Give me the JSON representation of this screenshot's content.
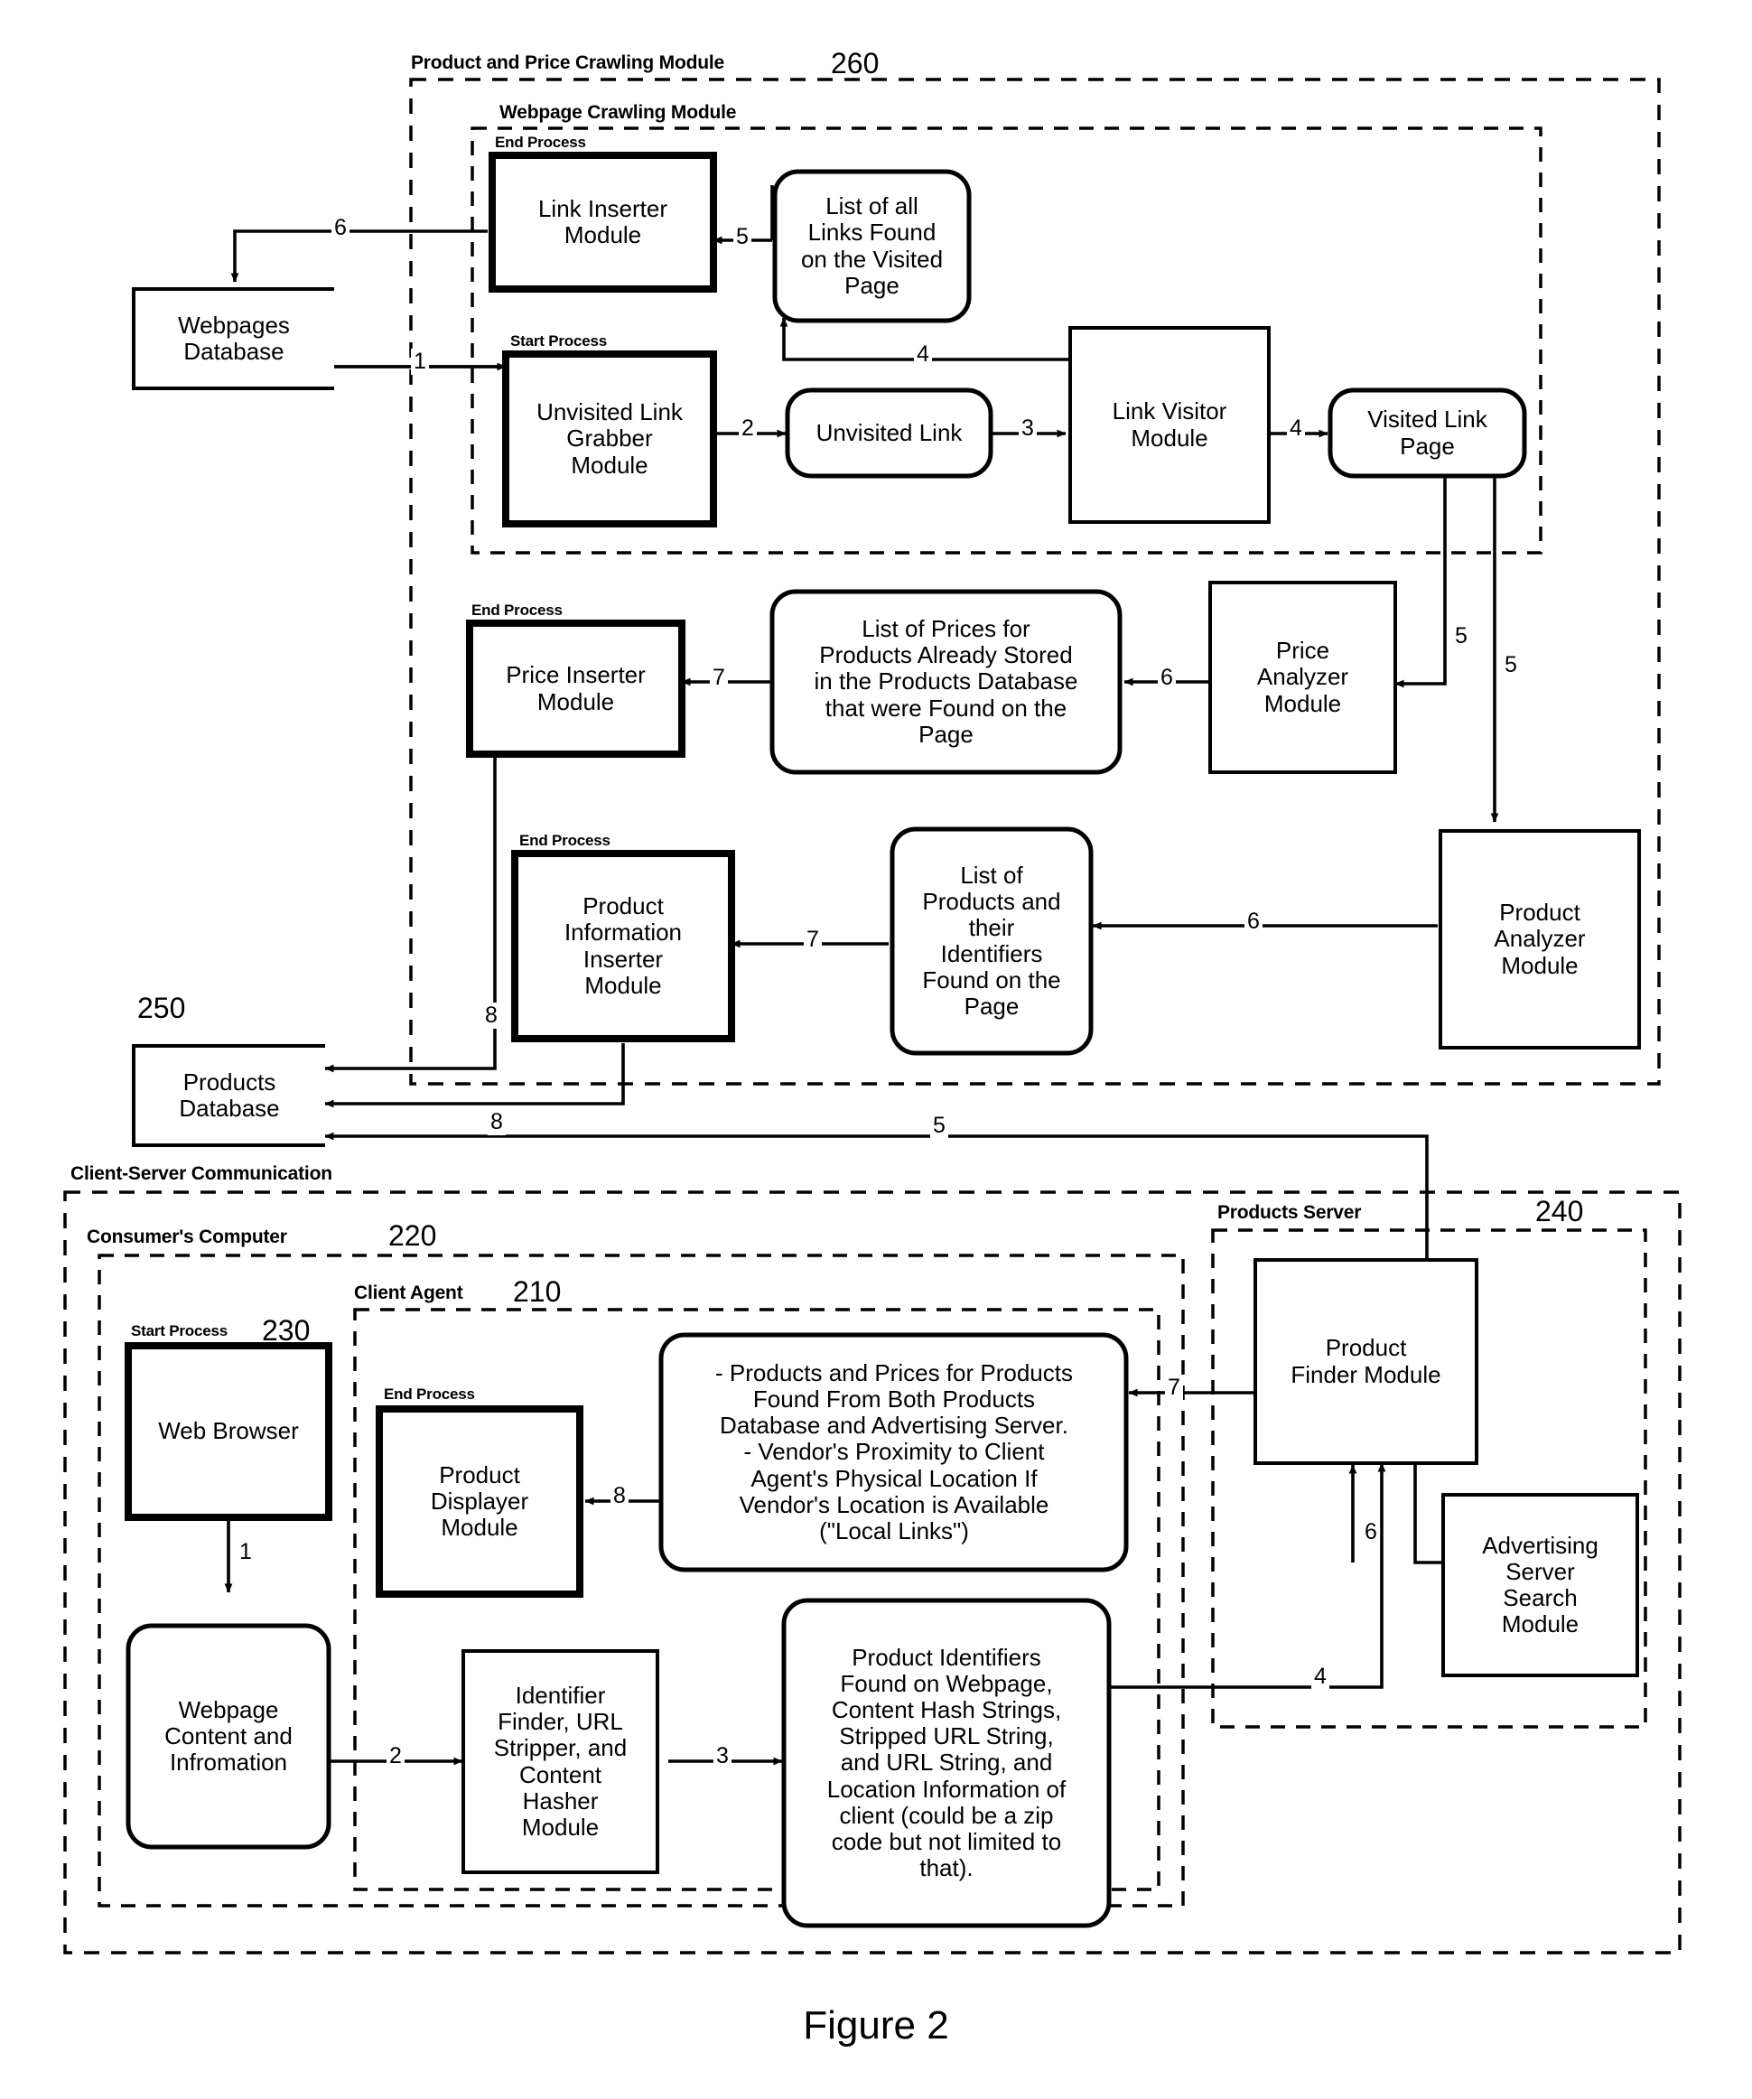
{
  "figure": {
    "caption": "Figure 2"
  },
  "containers": [
    {
      "id": "crawling",
      "label": "Product and Price Crawling Module",
      "ref": "260"
    },
    {
      "id": "webpage_crawl",
      "label": "Webpage Crawling Module",
      "ref": ""
    },
    {
      "id": "client_server",
      "label": "Client-Server Communication",
      "ref": ""
    },
    {
      "id": "consumer",
      "label": "Consumer's Computer",
      "ref": "220"
    },
    {
      "id": "client_agent",
      "label": "Client Agent",
      "ref": "210"
    },
    {
      "id": "products_server",
      "label": "Products Server",
      "ref": "240"
    }
  ],
  "nodes": [
    {
      "id": "webpages_db",
      "text": "Webpages Database",
      "tag": "",
      "ref": ""
    },
    {
      "id": "link_inserter",
      "text": "Link Inserter Module",
      "tag": "End Process",
      "ref": ""
    },
    {
      "id": "links_found",
      "text": "List of all Links Found on the Visited Page",
      "tag": "",
      "ref": ""
    },
    {
      "id": "unvisited_grabber",
      "text": "Unvisited Link Grabber Module",
      "tag": "Start Process",
      "ref": ""
    },
    {
      "id": "unvisited_link",
      "text": "Unvisited Link",
      "tag": "",
      "ref": ""
    },
    {
      "id": "link_visitor",
      "text": "Link Visitor Module",
      "tag": "",
      "ref": ""
    },
    {
      "id": "visited_link_page",
      "text": "Visited Link Page",
      "tag": "",
      "ref": ""
    },
    {
      "id": "price_inserter",
      "text": "Price Inserter Module",
      "tag": "End Process",
      "ref": ""
    },
    {
      "id": "price_list",
      "text": "List of Prices for Products Already Stored in the Products Database that were Found on the Page",
      "tag": "",
      "ref": ""
    },
    {
      "id": "price_analyzer",
      "text": "Price Analyzer Module",
      "tag": "",
      "ref": ""
    },
    {
      "id": "prod_info_inserter",
      "text": "Product Information Inserter Module",
      "tag": "End Process",
      "ref": ""
    },
    {
      "id": "prod_list",
      "text": "List of Products and their Identifiers Found on the Page",
      "tag": "",
      "ref": ""
    },
    {
      "id": "product_analyzer",
      "text": "Product Analyzer Module",
      "tag": "",
      "ref": ""
    },
    {
      "id": "products_db",
      "text": "Products Database",
      "tag": "",
      "ref": "250"
    },
    {
      "id": "web_browser",
      "text": "Web Browser",
      "tag": "Start Process",
      "ref": "230"
    },
    {
      "id": "prod_displayer",
      "text": "Product Displayer Module",
      "tag": "End Process",
      "ref": ""
    },
    {
      "id": "results_note",
      "text": "- Products and Prices for Products Found From Both Products Database and Advertising Server. - Vendor's Proximity to Client Agent's Physical Location If Vendor's Location is Available (\"Local Links\")",
      "tag": "",
      "ref": ""
    },
    {
      "id": "webpage_content",
      "text": "Webpage Content and Infromation",
      "tag": "",
      "ref": ""
    },
    {
      "id": "identifier_finder",
      "text": "Identifier Finder, URL Stripper, and Content Hasher Module",
      "tag": "",
      "ref": ""
    },
    {
      "id": "prod_identifiers",
      "text": "Product Identifiers Found on Webpage, Content Hash Strings, Stripped URL String, and URL String, and Location Information of client (could be a zip code but not limited to that).",
      "tag": "",
      "ref": ""
    },
    {
      "id": "product_finder",
      "text": "Product Finder Module",
      "tag": "",
      "ref": ""
    },
    {
      "id": "ad_server_search",
      "text": "Advertising Server Search Module",
      "tag": "",
      "ref": ""
    }
  ],
  "node_lines": {
    "webpages_db": [
      "Webpages",
      "Database"
    ],
    "link_inserter": [
      "Link Inserter",
      "Module"
    ],
    "links_found": [
      "List of all",
      "Links Found",
      "on the Visited",
      "Page"
    ],
    "unvisited_grabber": [
      "Unvisited Link",
      "Grabber",
      "Module"
    ],
    "unvisited_link": [
      "Unvisited Link"
    ],
    "link_visitor": [
      "Link Visitor",
      "Module"
    ],
    "visited_link_page": [
      "Visited Link",
      "Page"
    ],
    "price_inserter": [
      "Price Inserter",
      "Module"
    ],
    "price_list": [
      "List of Prices for",
      "Products Already Stored",
      "in the Products Database",
      "that were Found on the",
      "Page"
    ],
    "price_analyzer": [
      "Price",
      "Analyzer",
      "Module"
    ],
    "prod_info_inserter": [
      "Product",
      "Information",
      "Inserter",
      "Module"
    ],
    "prod_list": [
      "List of",
      "Products and",
      "their",
      "Identifiers",
      "Found on the",
      "Page"
    ],
    "product_analyzer": [
      "Product",
      "Analyzer",
      "Module"
    ],
    "products_db": [
      "Products",
      "Database"
    ],
    "web_browser": [
      "Web Browser"
    ],
    "prod_displayer": [
      "Product",
      "Displayer",
      "Module"
    ],
    "results_note": [
      "- Products and Prices for Products",
      "Found From Both Products",
      "Database and Advertising Server.",
      "- Vendor's Proximity to Client",
      "Agent's Physical Location If",
      "Vendor's Location is Available",
      "(\"Local Links\")"
    ],
    "webpage_content": [
      "Webpage",
      "Content and",
      "Infromation"
    ],
    "identifier_finder": [
      "Identifier",
      "Finder, URL",
      "Stripper, and",
      "Content",
      "Hasher",
      "Module"
    ],
    "prod_identifiers": [
      "Product Identifiers",
      "Found on Webpage,",
      "Content Hash Strings,",
      "Stripped URL String,",
      "and URL String, and",
      "Location Information of",
      "client (could be a zip",
      "code but not limited to",
      "that)."
    ],
    "product_finder": [
      "Product",
      "Finder Module"
    ],
    "ad_server_search": [
      "Advertising",
      "Server",
      "Search",
      "Module"
    ]
  },
  "flow_labels": [
    {
      "id": "f1a",
      "text": "6"
    },
    {
      "id": "f1b",
      "text": "5"
    },
    {
      "id": "f2",
      "text": "1"
    },
    {
      "id": "f3",
      "text": "2"
    },
    {
      "id": "f4",
      "text": "3"
    },
    {
      "id": "f5",
      "text": "4"
    },
    {
      "id": "f6",
      "text": "4"
    },
    {
      "id": "f7",
      "text": "5"
    },
    {
      "id": "f8",
      "text": "5"
    },
    {
      "id": "f9",
      "text": "7"
    },
    {
      "id": "f10",
      "text": "6"
    },
    {
      "id": "f11",
      "text": "7"
    },
    {
      "id": "f12",
      "text": "6"
    },
    {
      "id": "f13",
      "text": "8"
    },
    {
      "id": "f14",
      "text": "8"
    },
    {
      "id": "f15",
      "text": "5"
    },
    {
      "id": "f16",
      "text": "1"
    },
    {
      "id": "f17",
      "text": "8"
    },
    {
      "id": "f18",
      "text": "2"
    },
    {
      "id": "f19",
      "text": "3"
    },
    {
      "id": "f20",
      "text": "4"
    },
    {
      "id": "f21",
      "text": "6"
    },
    {
      "id": "f22",
      "text": "7"
    }
  ],
  "colors": {
    "ink": "#000000",
    "paper": "#ffffff"
  }
}
